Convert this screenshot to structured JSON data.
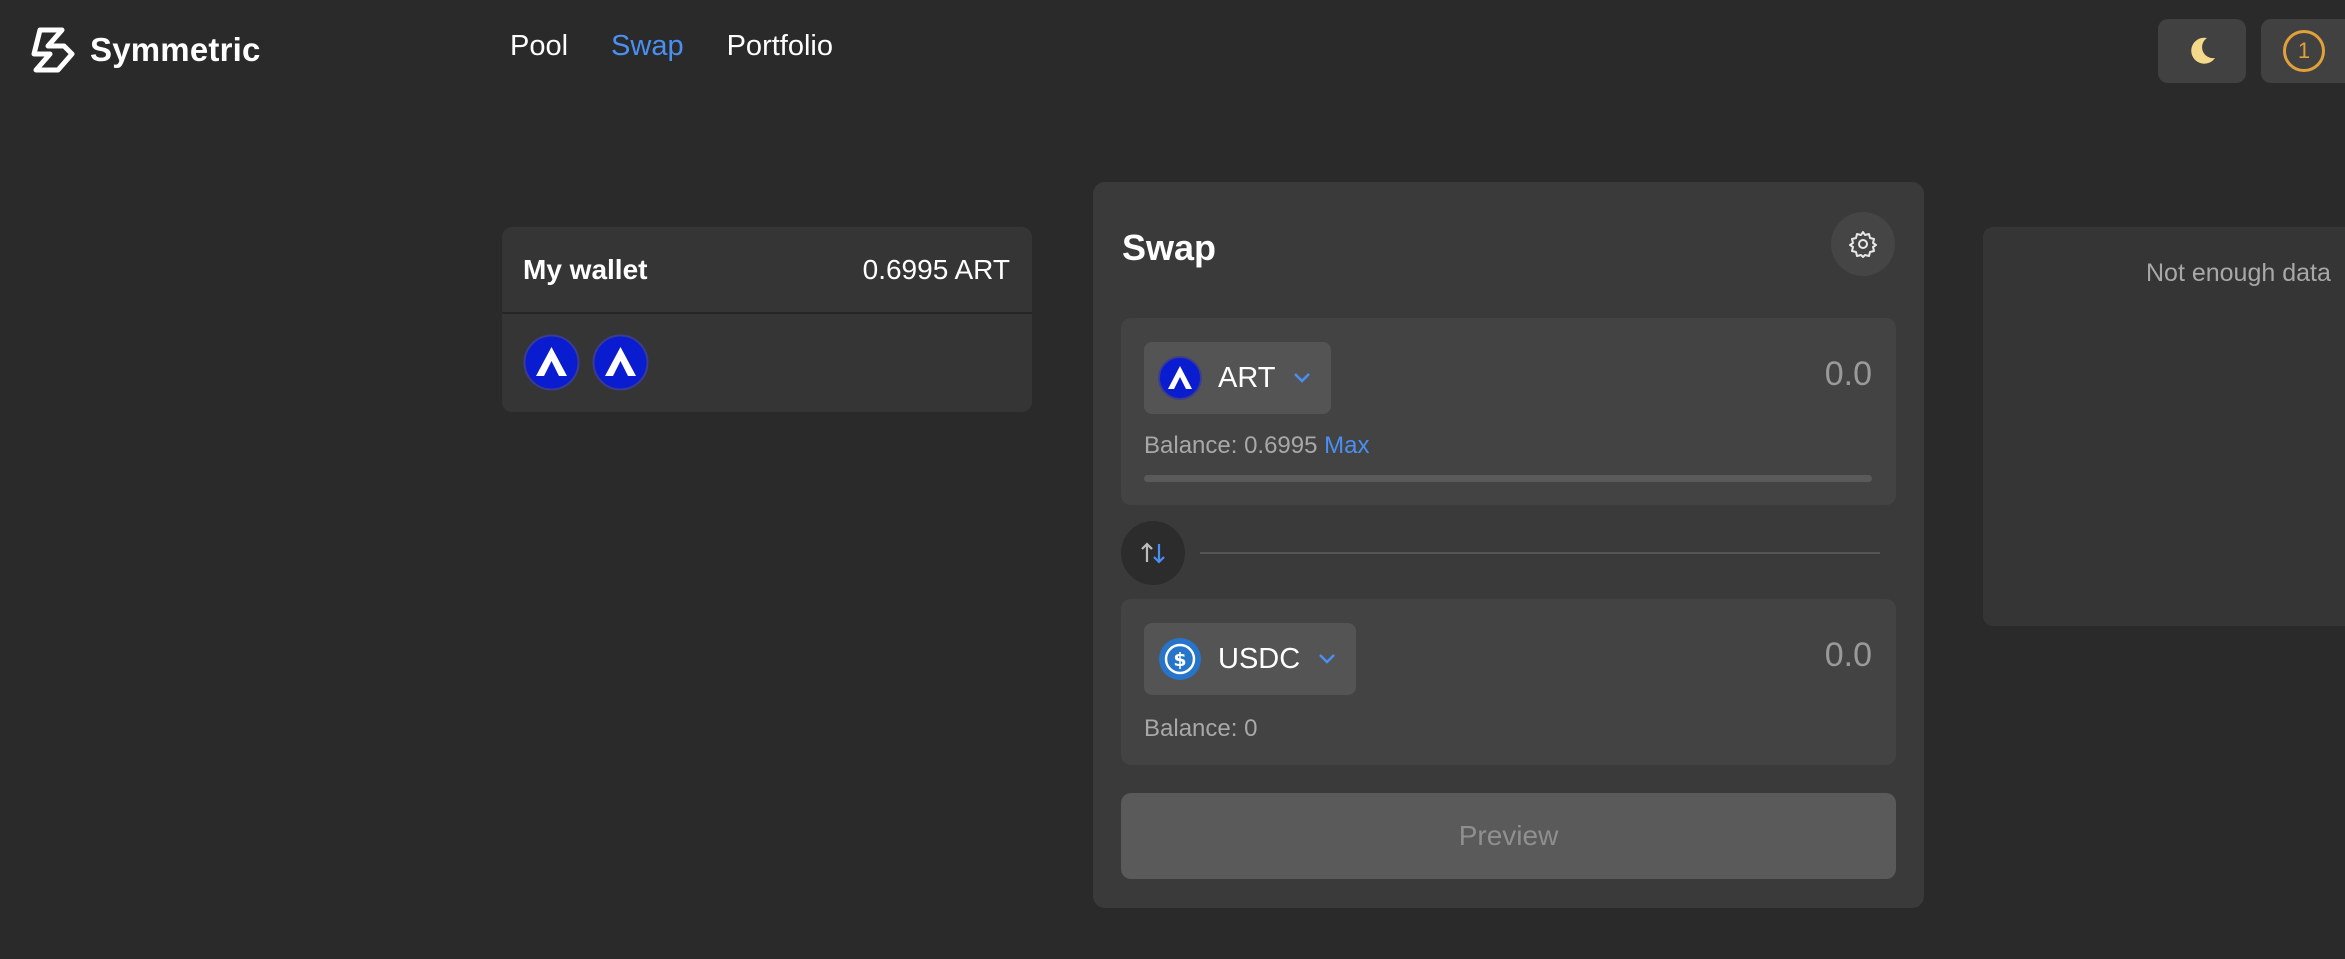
{
  "app": {
    "name": "Symmetric"
  },
  "nav": {
    "items": [
      {
        "label": "Pool",
        "active": false
      },
      {
        "label": "Swap",
        "active": true
      },
      {
        "label": "Portfolio",
        "active": false
      }
    ]
  },
  "header": {
    "theme_icon": "moon-icon",
    "account_badge": "1"
  },
  "wallet": {
    "title": "My wallet",
    "balance": "0.6995 ART",
    "tokens": [
      "ART",
      "ART"
    ]
  },
  "swap": {
    "title": "Swap",
    "from": {
      "symbol": "ART",
      "amount": "0.0",
      "balance_label": "Balance: 0.6995",
      "max_label": "Max"
    },
    "to": {
      "symbol": "USDC",
      "amount": "0.0",
      "balance_label": "Balance: 0"
    },
    "preview_label": "Preview"
  },
  "chart": {
    "message": "Not enough data"
  },
  "colors": {
    "accent": "#4a8ff2",
    "art_token": "#0a1ccf",
    "usdc_token": "#2775ca",
    "badge": "#e0a03a"
  }
}
